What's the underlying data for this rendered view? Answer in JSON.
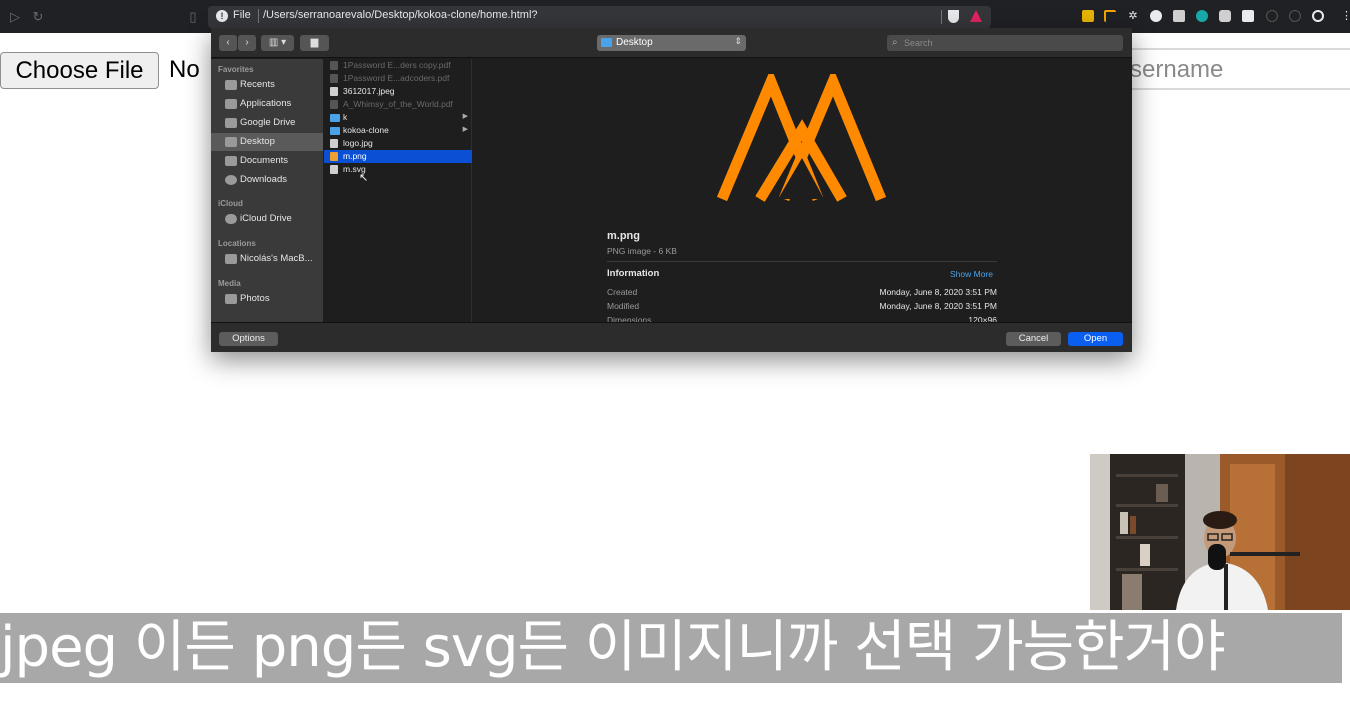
{
  "browser": {
    "url_scheme": "File",
    "url": "/Users/serranoarevalo/Desktop/kokoa-clone/home.html?"
  },
  "page": {
    "choose_file_label": "Choose File",
    "no_file_text": "No",
    "username_placeholder": "sername"
  },
  "dialog": {
    "location": "Desktop",
    "search_placeholder": "Search",
    "sidebar": {
      "favorites_head": "Favorites",
      "favorites": [
        "Recents",
        "Applications",
        "Google Drive",
        "Desktop",
        "Documents",
        "Downloads"
      ],
      "icloud_head": "iCloud",
      "icloud": [
        "iCloud Drive"
      ],
      "locations_head": "Locations",
      "locations": [
        "Nicolás's MacB..."
      ],
      "media_head": "Media",
      "media": [
        "Photos"
      ]
    },
    "files": [
      {
        "name": "1Password E...ders copy.pdf"
      },
      {
        "name": "1Password E...adcoders.pdf"
      },
      {
        "name": "3612017.jpeg"
      },
      {
        "name": "A_Whimsy_of_the_World.pdf"
      },
      {
        "name": "k"
      },
      {
        "name": "kokoa-clone"
      },
      {
        "name": "logo.jpg"
      },
      {
        "name": "m.png"
      },
      {
        "name": "m.svg"
      }
    ],
    "preview": {
      "name": "m.png",
      "kind": "PNG image - 6 KB",
      "info_head": "Information",
      "show_more": "Show More",
      "created_label": "Created",
      "created_value": "Monday, June 8, 2020 3:51 PM",
      "modified_label": "Modified",
      "modified_value": "Monday, June 8, 2020 3:51 PM",
      "dimensions_label": "Dimensions",
      "dimensions_value": "120×96",
      "logo_color": "#ff8a00"
    },
    "options_label": "Options",
    "cancel_label": "Cancel",
    "open_label": "Open"
  },
  "subtitle": "jpeg 이든 png든 svg든 이미지니까 선택 가능한거야"
}
